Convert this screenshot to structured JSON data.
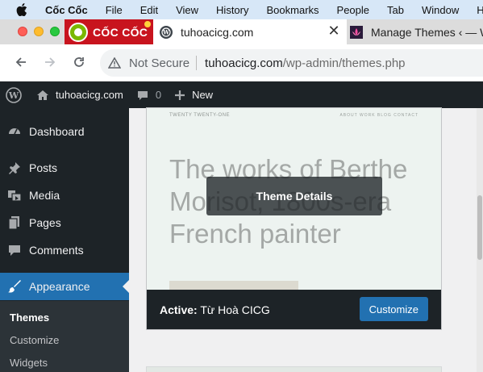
{
  "menubar": {
    "items": [
      "Cốc Cốc",
      "File",
      "Edit",
      "View",
      "History",
      "Bookmarks",
      "People",
      "Tab",
      "Window",
      "H"
    ]
  },
  "browser": {
    "logo_text": "CỐC CỐC",
    "active_tab": {
      "title": "tuhoacicg.com",
      "close": "✕"
    },
    "tab2": {
      "title": "Manage Themes ‹ — W"
    },
    "address": {
      "security": "Not Secure",
      "host": "tuhoacicg.com",
      "path": "/wp-admin/themes.php"
    }
  },
  "adminbar": {
    "site_name": "tuhoacicg.com",
    "comments_count": "0",
    "new_label": "New"
  },
  "sidebar": {
    "items": [
      {
        "label": "Dashboard",
        "icon": "dashboard-icon"
      },
      {
        "label": "Posts",
        "icon": "pushpin-icon"
      },
      {
        "label": "Media",
        "icon": "media-icon"
      },
      {
        "label": "Pages",
        "icon": "pages-icon"
      },
      {
        "label": "Comments",
        "icon": "comment-icon"
      },
      {
        "label": "Appearance",
        "icon": "paintbrush-icon"
      }
    ],
    "submenu": [
      "Themes",
      "Customize",
      "Widgets"
    ]
  },
  "theme": {
    "screenshot_site": "TWENTY TWENTY-ONE",
    "screenshot_nav": "ABOUT   WORK   BLOG   CONTACT",
    "screenshot_heading": "The works of Berthe Morisot, 1800s-era French painter",
    "details_label": "Theme Details",
    "active_prefix": "Active:",
    "active_name": "Từ Hoà CICG",
    "customize_label": "Customize"
  },
  "colors": {
    "wp_dark": "#1d2327",
    "wp_blue": "#2271b1",
    "menubar_bg": "#d7e7f7",
    "coccoc_red": "#c8141e"
  }
}
